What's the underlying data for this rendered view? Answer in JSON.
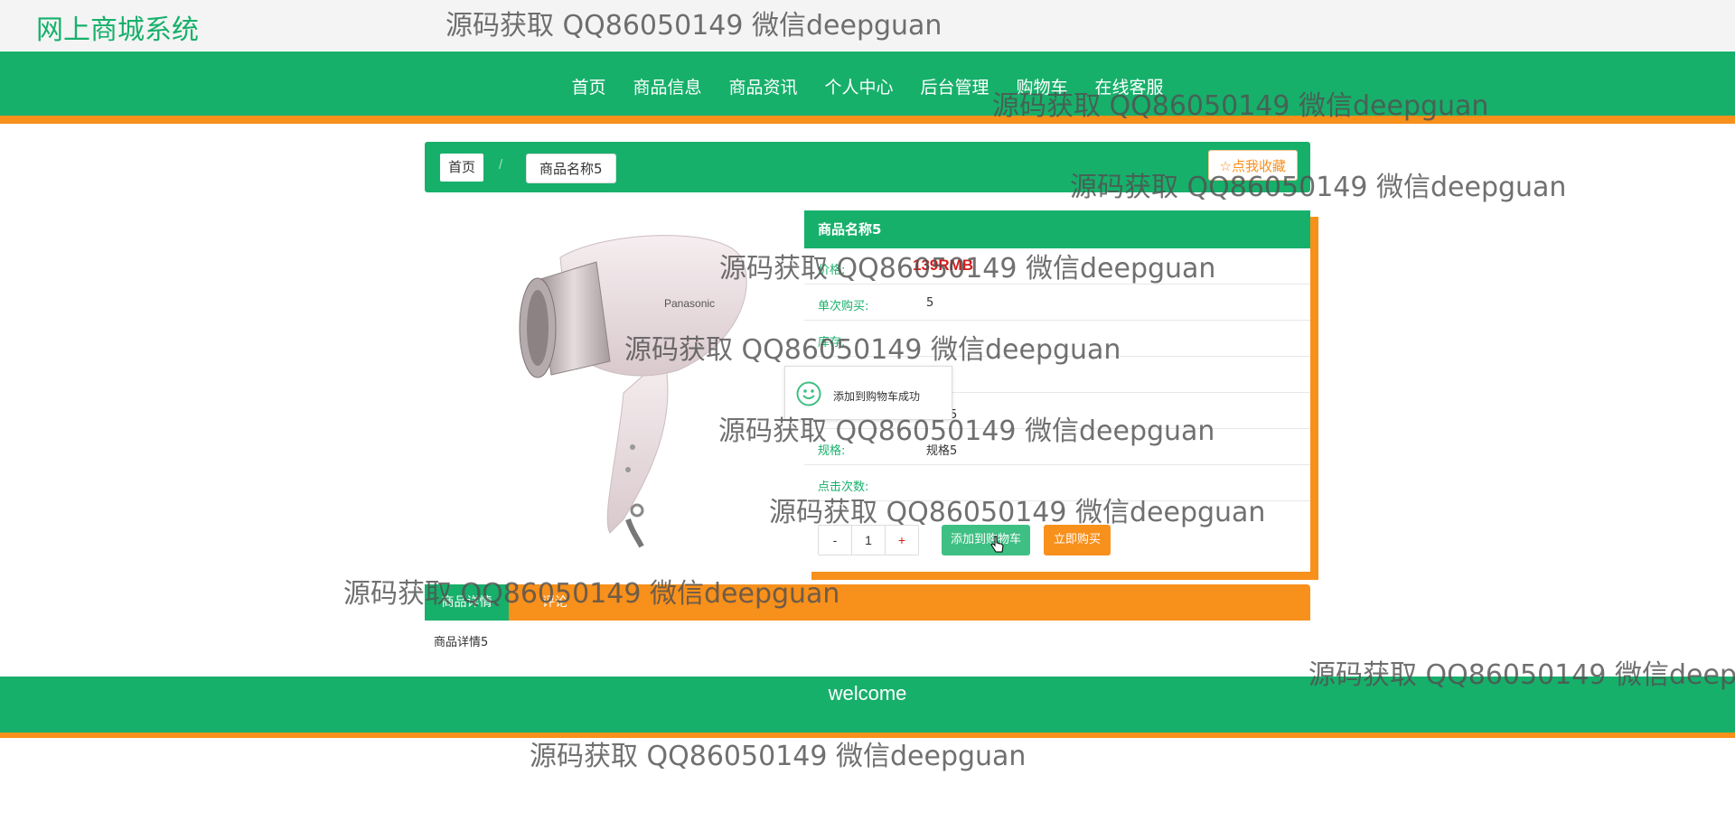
{
  "site": {
    "title": "网上商城系统"
  },
  "nav": {
    "items": [
      {
        "label": "首页"
      },
      {
        "label": "商品信息"
      },
      {
        "label": "商品资讯"
      },
      {
        "label": "个人中心"
      },
      {
        "label": "后台管理"
      },
      {
        "label": "购物车"
      },
      {
        "label": "在线客服"
      }
    ]
  },
  "breadcrumb": {
    "home": "首页",
    "separator": "/",
    "current": "商品名称5",
    "favorite": "☆点我收藏"
  },
  "product": {
    "name": "商品名称5",
    "image_brand_text": "Panasonic",
    "rows": [
      {
        "key": "价格:",
        "value": "139RMB"
      },
      {
        "key": "单次购买:",
        "value": "5"
      },
      {
        "key": "库存:",
        "value": ""
      },
      {
        "key": "",
        "value": ""
      },
      {
        "key": "品牌:",
        "value": "品牌5"
      },
      {
        "key": "规格:",
        "value": "规格5"
      },
      {
        "key": "点击次数:",
        "value": ""
      }
    ],
    "quantity": {
      "minus": "-",
      "value": "1",
      "plus": "+"
    },
    "add_to_cart": "添加到购物车",
    "buy_now": "立即购买"
  },
  "toast": {
    "message": "添加到购物车成功"
  },
  "tabs": {
    "details": "商品详情",
    "comments": "评论",
    "content": "商品详情5"
  },
  "footer": {
    "text": "welcome"
  },
  "watermark": {
    "text": "源码获取 QQ86050149 微信deepguan"
  },
  "colors": {
    "primary": "#17b06b",
    "accent": "#f8901c",
    "price": "#d31c1c"
  }
}
